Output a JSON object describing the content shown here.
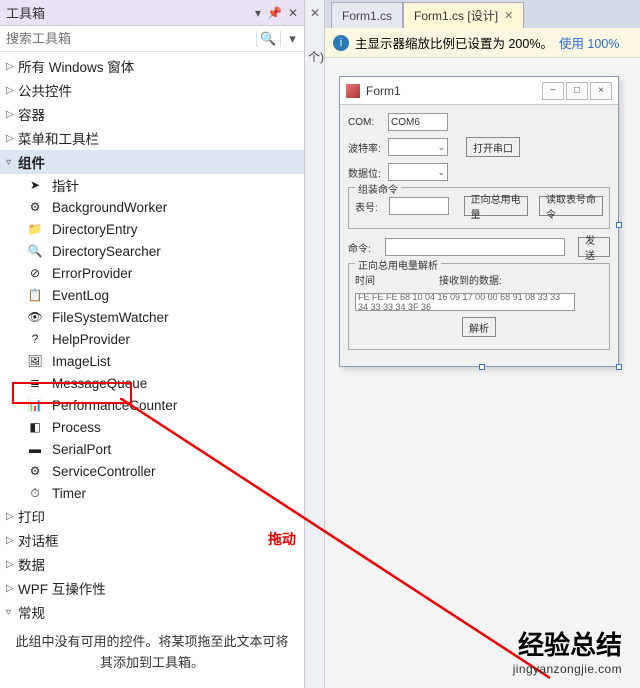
{
  "toolbox": {
    "title": "工具箱",
    "search_placeholder": "搜索工具箱",
    "categories": {
      "c0": "所有 Windows 窗体",
      "c1": "公共控件",
      "c2": "容器",
      "c3": "菜单和工具栏",
      "c4": "组件",
      "c5": "打印",
      "c6": "对话框",
      "c7": "数据",
      "c8": "WPF 互操作性",
      "c9": "常规"
    },
    "components": {
      "i0": "指针",
      "i1": "BackgroundWorker",
      "i2": "DirectoryEntry",
      "i3": "DirectorySearcher",
      "i4": "ErrorProvider",
      "i5": "EventLog",
      "i6": "FileSystemWatcher",
      "i7": "HelpProvider",
      "i8": "ImageList",
      "i9": "MessageQueue",
      "i10": "PerformanceCounter",
      "i11": "Process",
      "i12": "SerialPort",
      "i13": "ServiceController",
      "i14": "Timer"
    },
    "empty_msg": "此组中没有可用的控件。将某项拖至此文本可将其添加到工具箱。"
  },
  "tabs": {
    "t0": "Form1.cs",
    "t1": "Form1.cs [设计]"
  },
  "infobar": {
    "text": "主显示器缩放比例已设置为 200%。",
    "link": "使用 100%"
  },
  "form": {
    "title": "Form1",
    "labels": {
      "com": "COM:",
      "com_val": "COM6",
      "baud": "波特率:",
      "data": "数据位:",
      "open_btn": "打开串口",
      "group_read": "组装命令",
      "addr": "表号:",
      "btn_read": "正向总用电量",
      "btn_readno": "读取表号命令",
      "cmd": "命令:",
      "send": "发送",
      "group_parse": "正向总用电量解析",
      "time": "时间",
      "valchg": "接收到的数据:",
      "hex": "FE FE FE 68 10 04 16 09 17 00 00 68 91 08 33 33 34 33 33 34 3F 36",
      "parse": "解析"
    }
  },
  "annotation": {
    "drag": "拖动"
  },
  "watermark": {
    "big": "经验总结",
    "url": "jingyanzongjie.com"
  },
  "mid": {
    "paren": "个)"
  }
}
